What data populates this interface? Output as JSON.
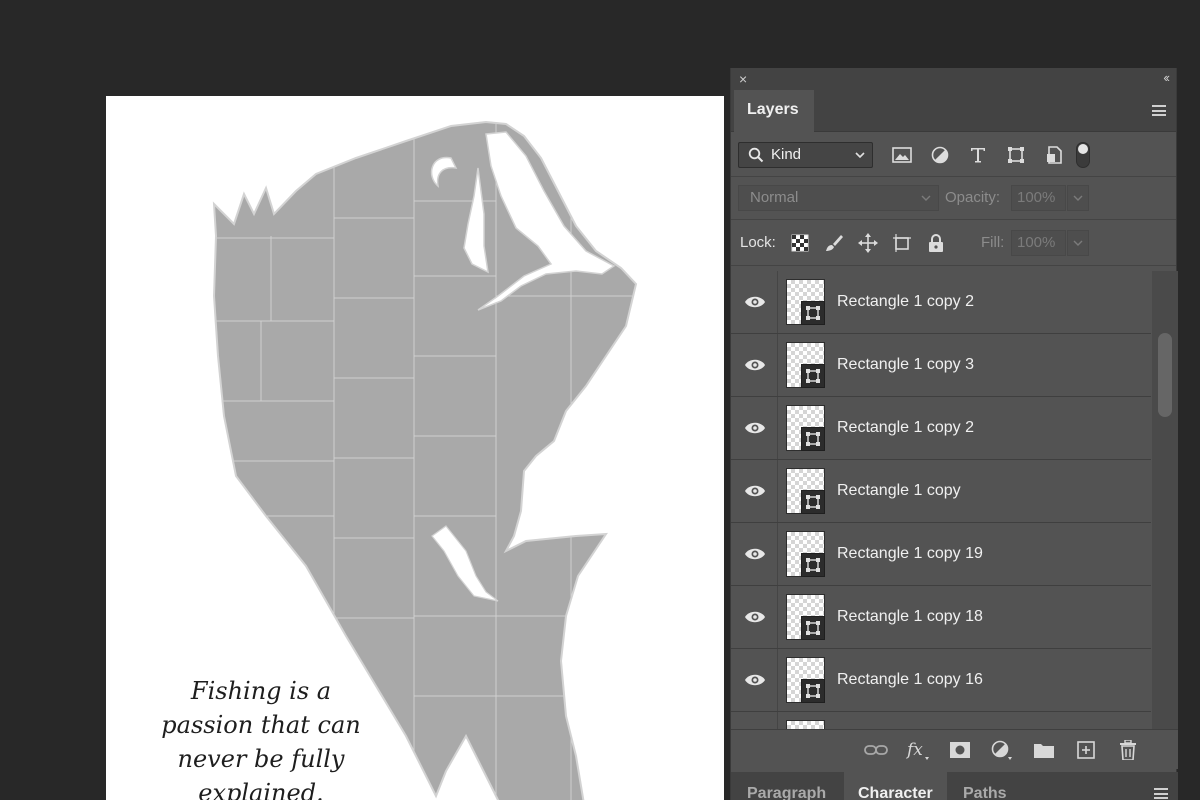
{
  "document": {
    "quote_lines": [
      "Fishing is a",
      "passion that can",
      "never be fully",
      "explained."
    ]
  },
  "panel": {
    "close_glyph": "×",
    "collapse_glyph": "‹‹",
    "tab_active": "Layers",
    "filter": {
      "kind_label": "Kind"
    },
    "blend": {
      "mode": "Normal",
      "opacity_label": "Opacity:",
      "opacity_value": "100%"
    },
    "lock": {
      "label": "Lock:",
      "fill_label": "Fill:",
      "fill_value": "100%"
    },
    "layers": [
      {
        "name": "Rectangle 1 copy 2"
      },
      {
        "name": "Rectangle 1 copy 3"
      },
      {
        "name": "Rectangle 1 copy 2"
      },
      {
        "name": "Rectangle 1 copy"
      },
      {
        "name": "Rectangle 1 copy 19"
      },
      {
        "name": "Rectangle 1 copy 18"
      },
      {
        "name": "Rectangle 1 copy 16"
      }
    ],
    "bottom_tabs": [
      "Paragraph",
      "Character",
      "Paths"
    ],
    "bottom_tab_active": "Character"
  },
  "colors": {
    "app_background": "#282828",
    "panel_background": "#535353",
    "fish_fill": "#a9a9a9",
    "fish_lines": "#d3d3d3"
  },
  "icons": {
    "filter": [
      "image-filter-icon",
      "adjustment-filter-icon",
      "type-filter-icon",
      "shape-filter-icon",
      "smart-object-filter-icon"
    ],
    "lock": [
      "lock-transparent-pixels-icon",
      "lock-image-pixels-icon",
      "lock-position-icon",
      "lock-artboard-icon",
      "lock-all-icon"
    ],
    "bottom": [
      "link-layers-icon",
      "fx-icon",
      "add-mask-icon",
      "adjustment-layer-icon",
      "new-group-icon",
      "new-layer-icon",
      "delete-layer-icon"
    ]
  }
}
